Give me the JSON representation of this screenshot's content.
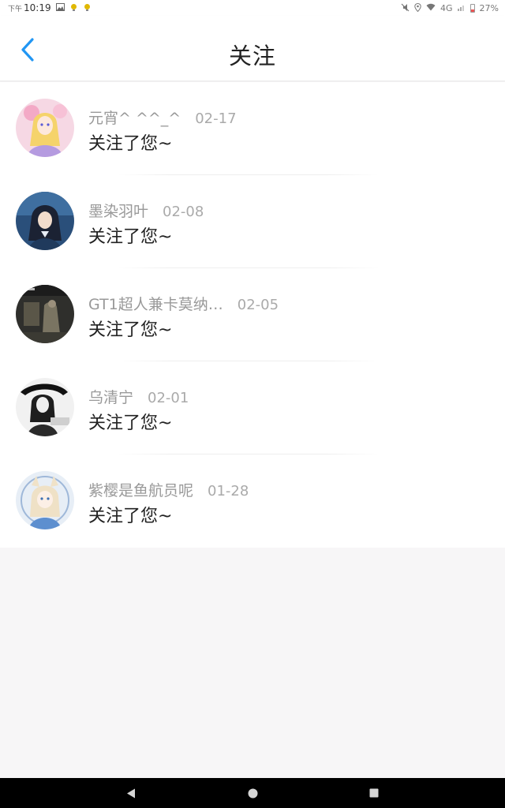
{
  "status_bar": {
    "ampm": "下午",
    "time": "10:19",
    "battery": "27%",
    "network": "4G"
  },
  "header": {
    "title": "关注"
  },
  "notifications": [
    {
      "name": "元宵^ ^^_^",
      "date": "02-17",
      "message": "关注了您~",
      "avatar_icon": "avatar-anime-pink"
    },
    {
      "name": "墨染羽叶",
      "date": "02-08",
      "message": "关注了您~",
      "avatar_icon": "avatar-anime-blue"
    },
    {
      "name": "GT1超人兼卡莫纳…",
      "date": "02-05",
      "message": "关注了您~",
      "avatar_icon": "avatar-game-dark"
    },
    {
      "name": "乌清宁",
      "date": "02-01",
      "message": "关注了您~",
      "avatar_icon": "avatar-ink-bw"
    },
    {
      "name": "紫樱是鱼航员呢",
      "date": "01-28",
      "message": "关注了您~",
      "avatar_icon": "avatar-anime-light"
    }
  ],
  "colors": {
    "accent": "#2196f3",
    "background": "#f7f6f7",
    "text_primary": "#222222",
    "text_secondary": "#999999"
  }
}
